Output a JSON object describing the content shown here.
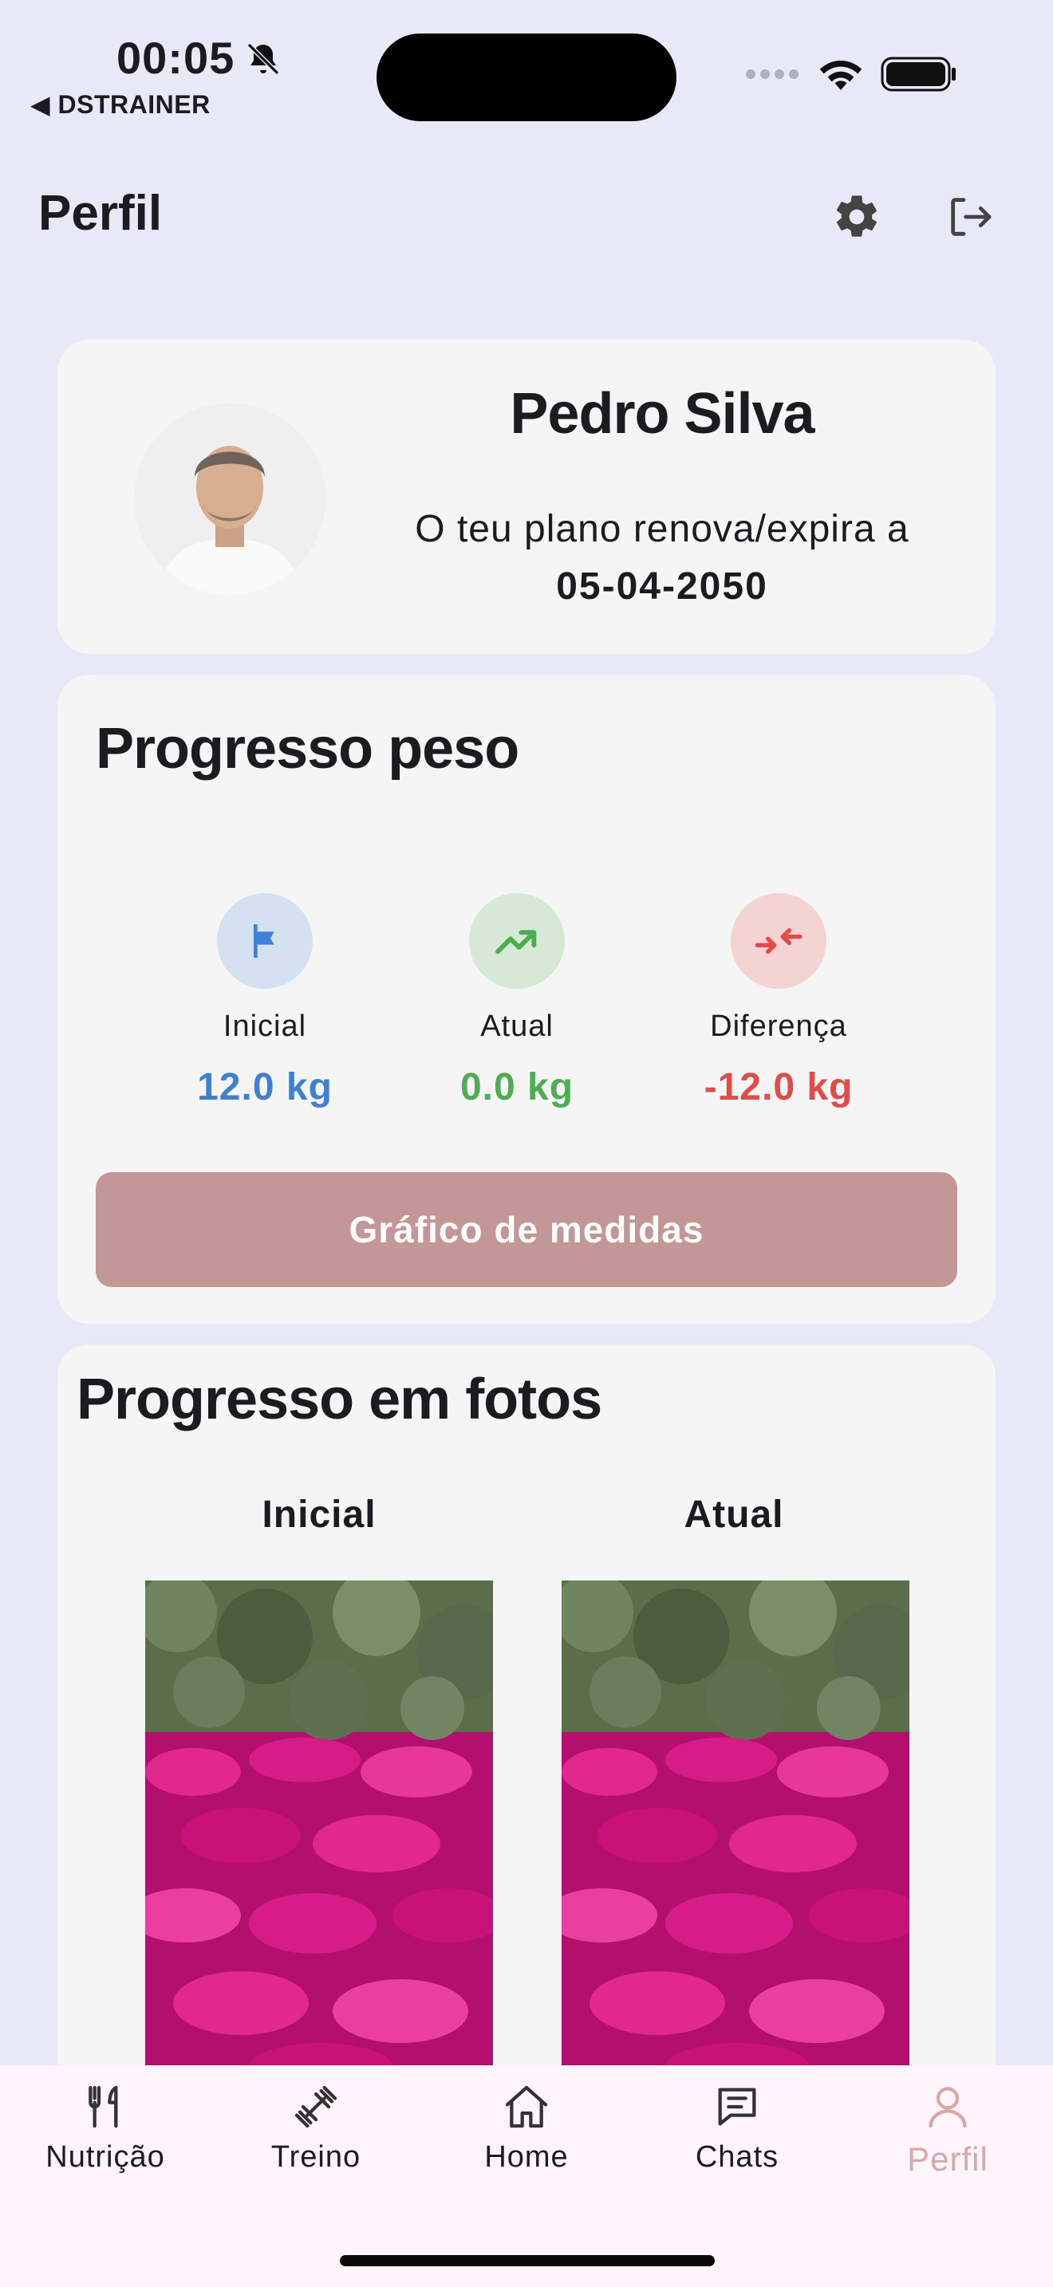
{
  "status_bar": {
    "time": "00:05",
    "back_app": "◀ DSTRAINER"
  },
  "header": {
    "title": "Perfil",
    "settings_icon": "gear-icon",
    "logout_icon": "logout-icon"
  },
  "profile": {
    "name": "Pedro Silva",
    "plan_text": "O teu plano renova/expira a",
    "plan_date": "05-04-2050"
  },
  "weight_progress": {
    "title": "Progresso peso",
    "stats": [
      {
        "label": "Inicial",
        "value": "12.0 kg",
        "icon": "flag-icon",
        "color": "#3f7fd4",
        "bg": "#d4e1f1"
      },
      {
        "label": "Atual",
        "value": "0.0 kg",
        "icon": "trending-up-icon",
        "color": "#4cae50",
        "bg": "#d6e9d6"
      },
      {
        "label": "Diferença",
        "value": "-12.0 kg",
        "icon": "compare-arrows-icon",
        "color": "#e44a47",
        "bg": "#f5d3d3"
      }
    ],
    "chart_button": "Gráfico de medidas"
  },
  "photo_progress": {
    "title": "Progresso em fotos",
    "initial_label": "Inicial",
    "current_label": "Atual"
  },
  "nav": {
    "items": [
      {
        "label": "Nutrição",
        "icon": "fork-knife-icon"
      },
      {
        "label": "Treino",
        "icon": "dumbbell-icon"
      },
      {
        "label": "Home",
        "icon": "home-icon"
      },
      {
        "label": "Chats",
        "icon": "chat-icon"
      },
      {
        "label": "Perfil",
        "icon": "person-icon"
      }
    ],
    "active": "Perfil",
    "active_color": "#d9a7a7"
  }
}
